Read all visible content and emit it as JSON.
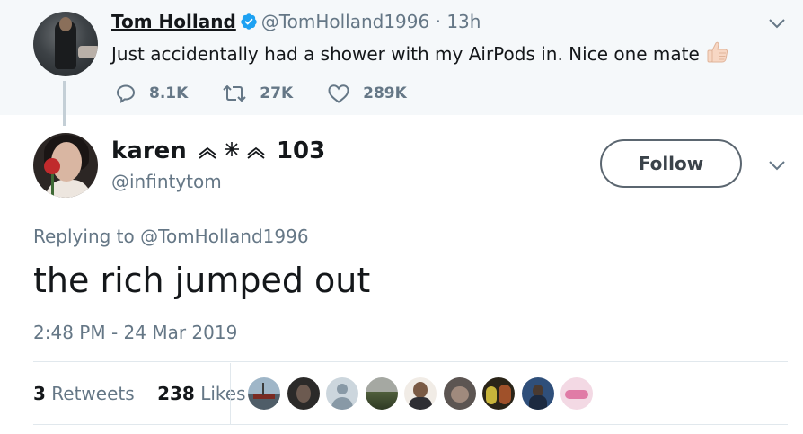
{
  "parent_tweet": {
    "name": "Tom Holland",
    "handle": "@TomHolland1996",
    "separator": "·",
    "time": "13h",
    "text": "Just accidentally had a shower with my AirPods in. Nice one mate",
    "emoji": "thumbs-up-icon",
    "reply_count": "8.1K",
    "retweet_count": "27K",
    "like_count": "289K"
  },
  "main_tweet": {
    "name": "karen",
    "name_suffix": "103",
    "handle": "@infintytom",
    "follow_label": "Follow",
    "replying_prefix": "Replying to",
    "replying_to": "@TomHolland1996",
    "text": "the rich jumped out",
    "timestamp": "2:48 PM - 24 Mar 2019",
    "retweets_count": "3",
    "retweets_label": "Retweets",
    "likes_count": "238",
    "likes_label": "Likes"
  },
  "colors": {
    "accent": "#1da1f2",
    "muted_text": "#657786",
    "parent_bg": "#f5f8fa"
  }
}
